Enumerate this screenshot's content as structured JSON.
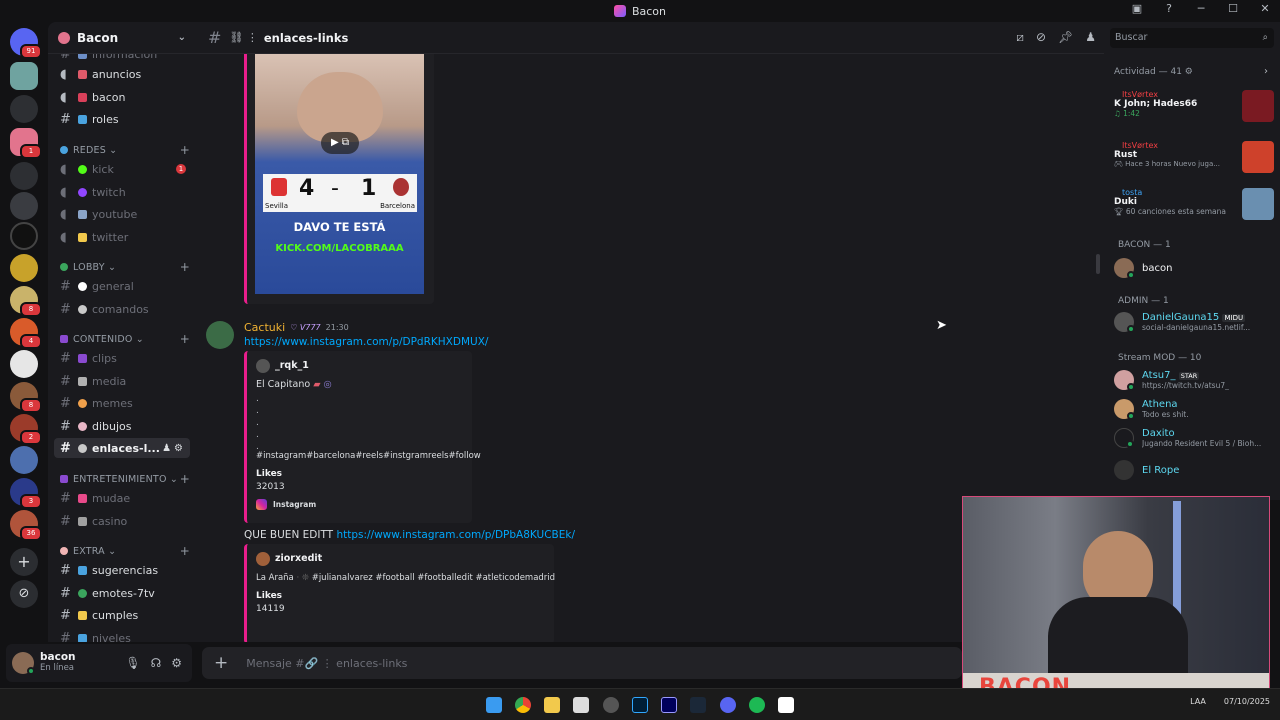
{
  "window": {
    "title": "Bacon"
  },
  "server_rail": {
    "badges": [
      "91",
      "1",
      "8",
      "4",
      "8",
      "2",
      "3",
      "36"
    ]
  },
  "sidebar": {
    "guild_name": "Bacon",
    "top_channels": [
      {
        "name": "informacion"
      },
      {
        "name": "anuncios"
      },
      {
        "name": "bacon"
      },
      {
        "name": "roles"
      }
    ],
    "categories": [
      {
        "name": "REDES",
        "channels": [
          "kick",
          "twitch",
          "youtube",
          "twitter"
        ]
      },
      {
        "name": "LOBBY",
        "channels": [
          "general",
          "comandos"
        ]
      },
      {
        "name": "CONTENIDO",
        "channels": [
          "clips",
          "media",
          "memes",
          "dibujos",
          "enlaces-l..."
        ]
      },
      {
        "name": "ENTRETENIMIENTO",
        "channels": [
          "mudae",
          "casino"
        ]
      },
      {
        "name": "EXTRA",
        "channels": [
          "sugerencias",
          "emotes-7tv",
          "cumples",
          "niveles"
        ]
      }
    ],
    "kick_mention": "1"
  },
  "user_panel": {
    "username": "bacon",
    "status": "En línea"
  },
  "chat_header": {
    "channel": "enlaces-links"
  },
  "messages": {
    "thumbnail": {
      "score_home": "4",
      "score_sep": "-",
      "score_away": "1",
      "team_home": "Sevilla",
      "team_away": "Barcelona",
      "line1": "DAVO TE ESTÁ",
      "line2": "KICK.COM/LACOBRAAA"
    },
    "msg1": {
      "author": "Cactuki",
      "tag": "V777",
      "time": "21:30",
      "link": "https://www.instagram.com/p/DPdRKHXDMUX/",
      "embed": {
        "author": "_rqk_1",
        "caption": "El Capitano",
        "dots": [
          ".",
          ".",
          ".",
          ".",
          "."
        ],
        "hashtags": "#instagram#barcelona#reels#instgramreels#follow",
        "likes_label": "Likes",
        "likes_value": "32013",
        "provider": "Instagram"
      }
    },
    "msg2": {
      "text": "QUE BUEN EDITT",
      "link": "https://www.instagram.com/p/DPbA8KUCBEk/",
      "embed": {
        "author": "ziorxedit",
        "caption": "La Araña",
        "hashtags": "#julianalvarez #football #footballedit #atleticodemadrid",
        "likes_label": "Likes",
        "likes_value": "14119"
      }
    }
  },
  "composer": {
    "placeholder": "Mensaje #🔗 ⋮ enlaces-links"
  },
  "right_panel": {
    "search_placeholder": "Buscar",
    "activity_header": "Actividad — 41",
    "activities": [
      {
        "user": "ItsVørtex",
        "title": "K John; Hades66",
        "sub": "1:42"
      },
      {
        "user": "ItsVørtex",
        "title": "Rust",
        "sub": "Hace 3 horas   Nuevo juga..."
      },
      {
        "user": "tosta",
        "title": "Duki",
        "sub": "60 canciones esta semana"
      }
    ],
    "groups": [
      {
        "name": "BACON — 1",
        "members": [
          {
            "name": "bacon",
            "sub": ""
          }
        ]
      },
      {
        "name": "ADMIN — 1",
        "members": [
          {
            "name": "DanielGauna15",
            "badge": "MIDU",
            "sub": "social-danielgauna15.netlif..."
          }
        ]
      },
      {
        "name": "Stream MOD — 10",
        "members": [
          {
            "name": "Atsu7_",
            "badge": "STAR",
            "sub": "https://twitch.tv/atsu7_"
          },
          {
            "name": "Athena",
            "sub": "Todo es shit."
          },
          {
            "name": "Daxito",
            "sub": "Jugando Resident Evil 5 / Bioh..."
          },
          {
            "name": "El Rope",
            "sub": ""
          }
        ]
      }
    ]
  },
  "webcam": {
    "banner": "BACON"
  },
  "taskbar": {
    "lang": "LAA",
    "date": "07/10/2025"
  },
  "colors": {
    "accent_link": "#00a8fc",
    "embed_border": "#e91e8c",
    "online": "#23a55a",
    "mention": "#da373c",
    "author_cactuki": "#f0b232",
    "author_blue": "#3ea3f5",
    "activity_user": "#f23f43"
  }
}
